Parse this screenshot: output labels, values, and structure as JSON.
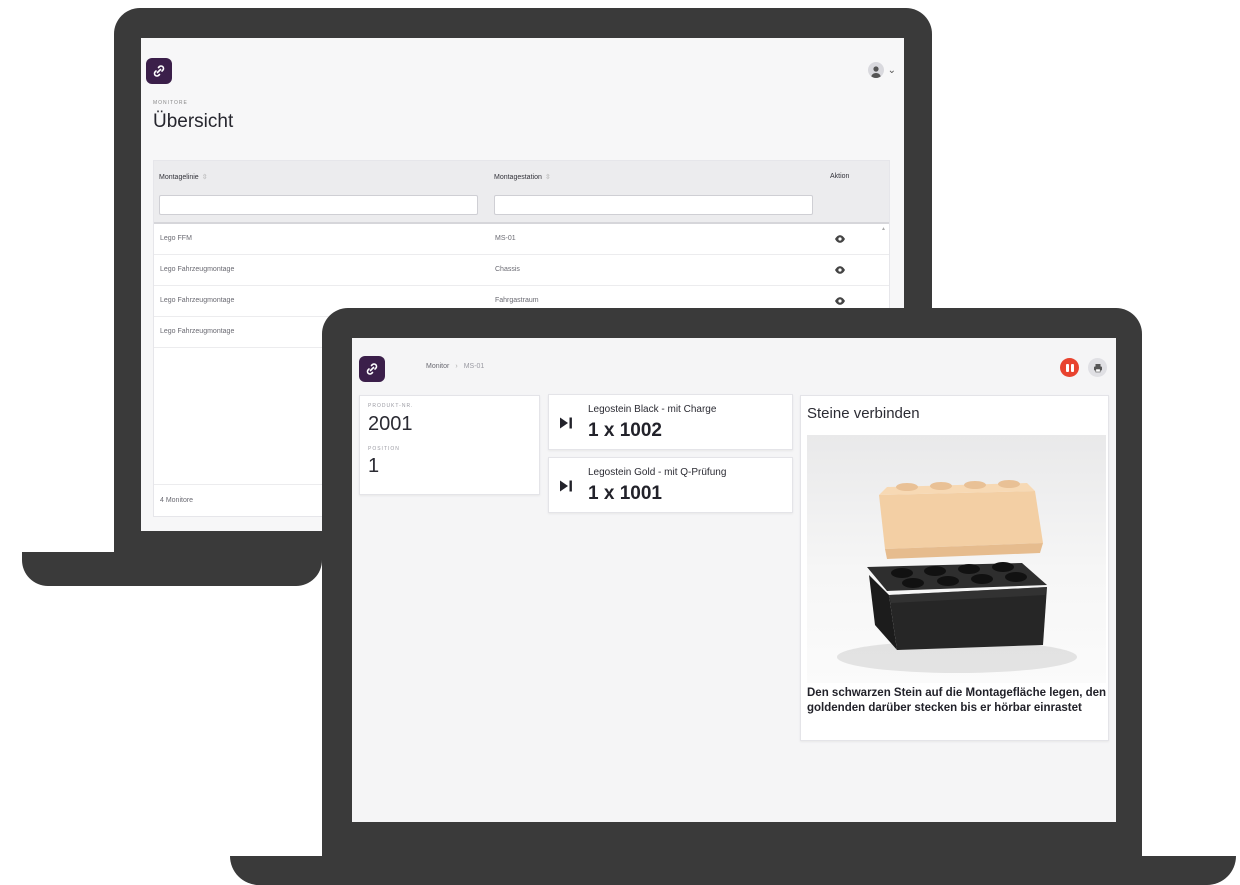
{
  "colors": {
    "brand": "#3b1f4a",
    "pause": "#e8432f"
  },
  "back_screen": {
    "overline": "MONITORE",
    "title": "Übersicht",
    "columns": [
      "Montagelinie",
      "Montagestation",
      "Aktion"
    ],
    "rows": [
      {
        "line": "Lego FFM",
        "station": "MS-01"
      },
      {
        "line": "Lego Fahrzeugmontage",
        "station": "Chassis"
      },
      {
        "line": "Lego Fahrzeugmontage",
        "station": "Fahrgastraum"
      },
      {
        "line": "Lego Fahrzeugmontage",
        "station": ""
      }
    ],
    "footer": "4 Monitore"
  },
  "front_screen": {
    "breadcrumb": [
      "Monitor",
      "MS-01"
    ],
    "product": {
      "label": "PRODUKT-NR.",
      "value": "2001"
    },
    "position": {
      "label": "POSITION",
      "value": "1"
    },
    "items": [
      {
        "name": "Legostein Black - mit Charge",
        "qty": "1 x 1002"
      },
      {
        "name": "Legostein Gold - mit Q-Prüfung",
        "qty": "1 x 1001"
      }
    ],
    "step": {
      "title": "Steine verbinden",
      "description": "Den schwarzen Stein auf die Montagefläche legen, den goldenden darüber stecken bis er hörbar einrastet"
    }
  }
}
